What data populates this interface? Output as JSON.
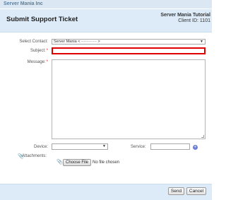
{
  "app": {
    "company": "Server Mania Inc"
  },
  "header": {
    "title": "Submit Support Ticket",
    "client_name": "Server Mania Tutorial",
    "client_id": "Client ID: 1101"
  },
  "form": {
    "select_contact_label": "Select Contact:",
    "select_contact_value": "Server Mania < ············ >",
    "subject_label": "Subject:",
    "subject_value": "",
    "message_label": "Message:",
    "message_value": "",
    "required_mark": "*",
    "device_label": "Device:",
    "device_value": "",
    "service_label": "Service:",
    "service_value": "",
    "attachments_label": "Attachments:",
    "choose_file_label": "Choose File",
    "no_file_text": "No file chosen"
  },
  "footer": {
    "send_label": "Send",
    "cancel_label": "Cancel"
  },
  "colors": {
    "header_bg": "#dcebf7",
    "subject_border": "#e00000",
    "service_icon": "#6d7fd8"
  },
  "icons": {
    "attachment": "paperclip-icon",
    "service_add": "service-plus-icon"
  }
}
